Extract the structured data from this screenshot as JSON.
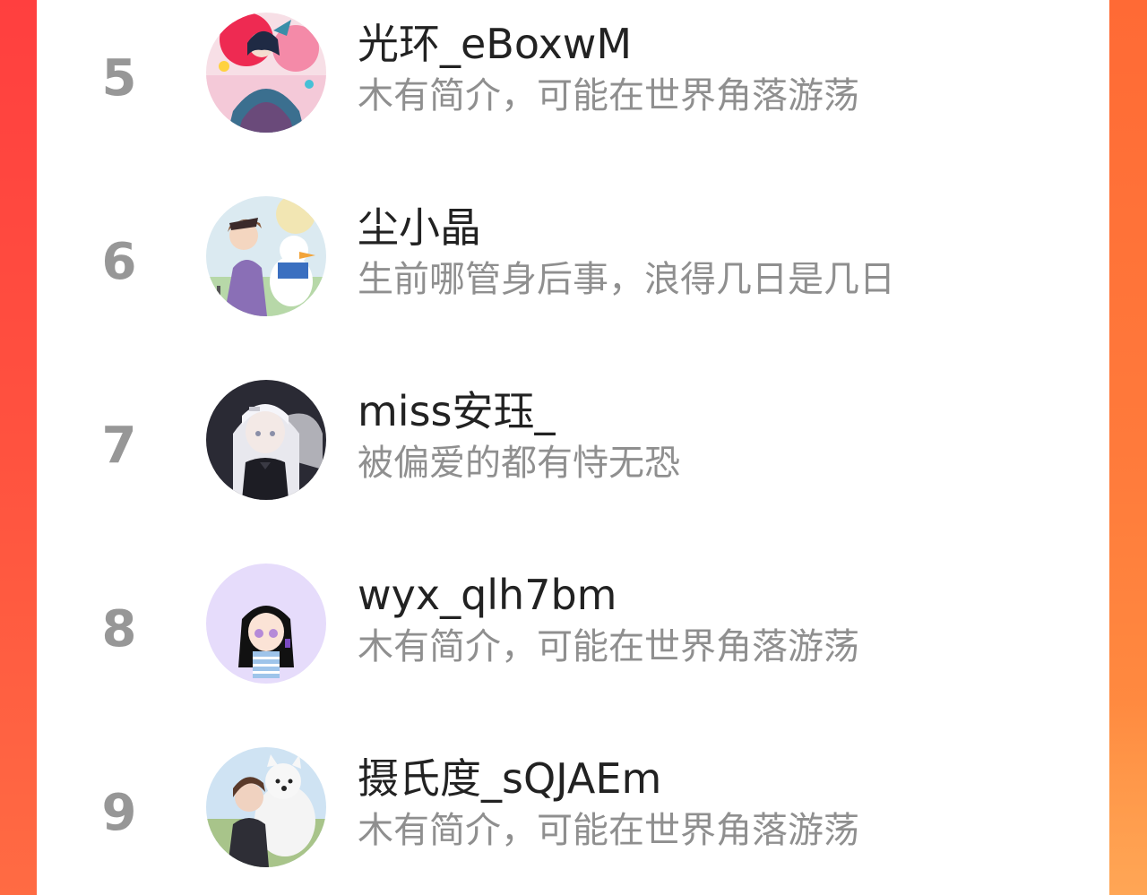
{
  "ranking": {
    "items": [
      {
        "rank": "5",
        "name": "光环_eBoxwM",
        "bio": "木有简介，可能在世界角落游荡",
        "avatar_icon": "anime-girl-red-avatar"
      },
      {
        "rank": "6",
        "name": "尘小晶",
        "bio": "生前哪管身后事，浪得几日是几日",
        "avatar_icon": "anime-boy-duck-avatar"
      },
      {
        "rank": "7",
        "name": "miss安珏_",
        "bio": "被偏爱的都有恃无恐",
        "avatar_icon": "anime-white-hair-avatar"
      },
      {
        "rank": "8",
        "name": "wyx_qlh7bm",
        "bio": "木有简介，可能在世界角落游荡",
        "avatar_icon": "chibi-girl-avatar"
      },
      {
        "rank": "9",
        "name": "摄氏度_sQJAEm",
        "bio": "木有简介，可能在世界角落游荡",
        "avatar_icon": "anime-girl-dog-avatar"
      }
    ]
  },
  "colors": {
    "rank_text": "#979797",
    "name_text": "#222222",
    "bio_text": "#8f8f8f",
    "accent_left": "#ff4a3d",
    "accent_right": "#ff7a3b"
  }
}
